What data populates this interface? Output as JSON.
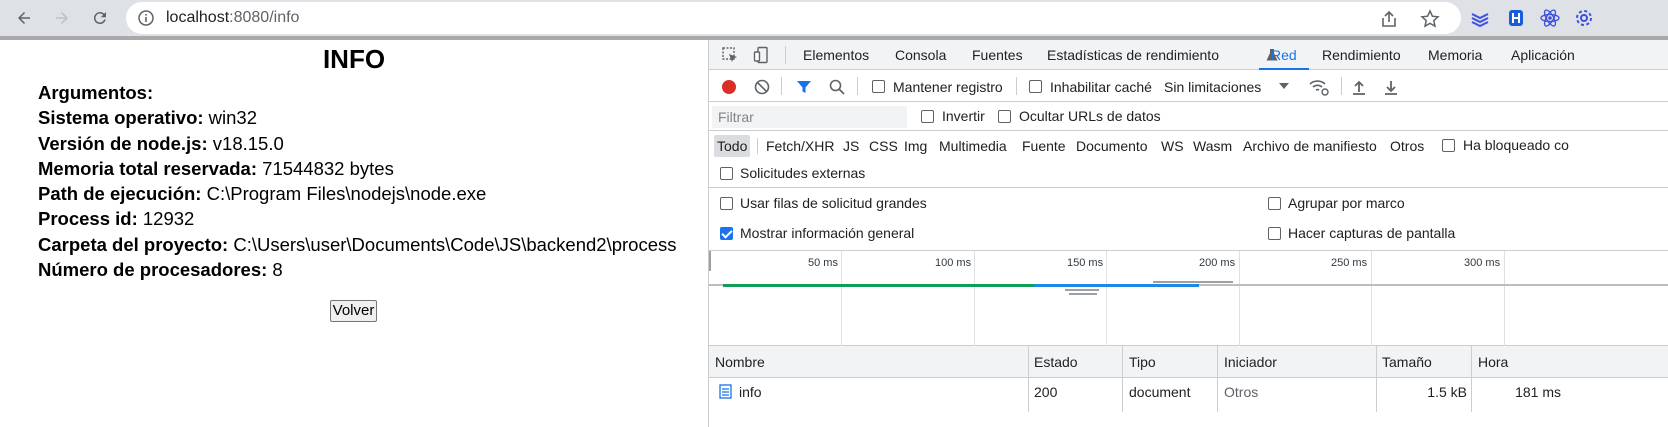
{
  "browser": {
    "url_host": "localhost",
    "url_path": ":8080/info"
  },
  "page": {
    "title": "INFO",
    "rows": [
      {
        "label": "Argumentos:",
        "value": ""
      },
      {
        "label": "Sistema operativo:",
        "value": "win32"
      },
      {
        "label": "Versión de node.js:",
        "value": "v18.15.0"
      },
      {
        "label": "Memoria total reservada:",
        "value": "71544832 bytes"
      },
      {
        "label": "Path de ejecución:",
        "value": "C:\\Program Files\\nodejs\\node.exe"
      },
      {
        "label": "Process id:",
        "value": "12932"
      },
      {
        "label": "Carpeta del proyecto:",
        "value": "C:\\Users\\user\\Documents\\Code\\JS\\backend2\\process"
      },
      {
        "label": "Número de procesadores:",
        "value": "8"
      }
    ],
    "back_button": "Volver"
  },
  "devtools": {
    "tabs": [
      "Elementos",
      "Consola",
      "Fuentes",
      "Estadísticas de rendimiento",
      "Red",
      "Rendimiento",
      "Memoria",
      "Aplicación"
    ],
    "active_tab": "Red",
    "toolbar": {
      "preserve_log": "Mantener registro",
      "disable_cache": "Inhabilitar caché",
      "throttling": "Sin limitaciones"
    },
    "filter": {
      "placeholder": "Filtrar",
      "invert": "Invertir",
      "hide_data_urls": "Ocultar URLs de datos"
    },
    "types": [
      "Todo",
      "Fetch/XHR",
      "JS",
      "CSS",
      "Img",
      "Multimedia",
      "Fuente",
      "Documento",
      "WS",
      "Wasm",
      "Archivo de manifiesto",
      "Otros"
    ],
    "active_type": "Todo",
    "blocked_cookies": "Ha bloqueado co",
    "external_requests": "Solicitudes externas",
    "settings": {
      "large_rows": "Usar filas de solicitud grandes",
      "group_by_frame": "Agrupar por marco",
      "show_overview": "Mostrar información general",
      "screenshots": "Hacer capturas de pantalla"
    },
    "timeline_ticks": [
      "50 ms",
      "100 ms",
      "150 ms",
      "200 ms",
      "250 ms",
      "300 ms"
    ],
    "columns": [
      "Nombre",
      "Estado",
      "Tipo",
      "Iniciador",
      "Tamaño",
      "Hora"
    ],
    "requests": [
      {
        "name": "info",
        "status": "200",
        "type": "document",
        "initiator": "Otros",
        "size": "1.5 kB",
        "time": "181 ms"
      }
    ],
    "colors": {
      "accent": "#1a73e8",
      "record": "#d93025",
      "timeline_green": "#0f9d58",
      "timeline_blue": "#1e88e5"
    }
  }
}
